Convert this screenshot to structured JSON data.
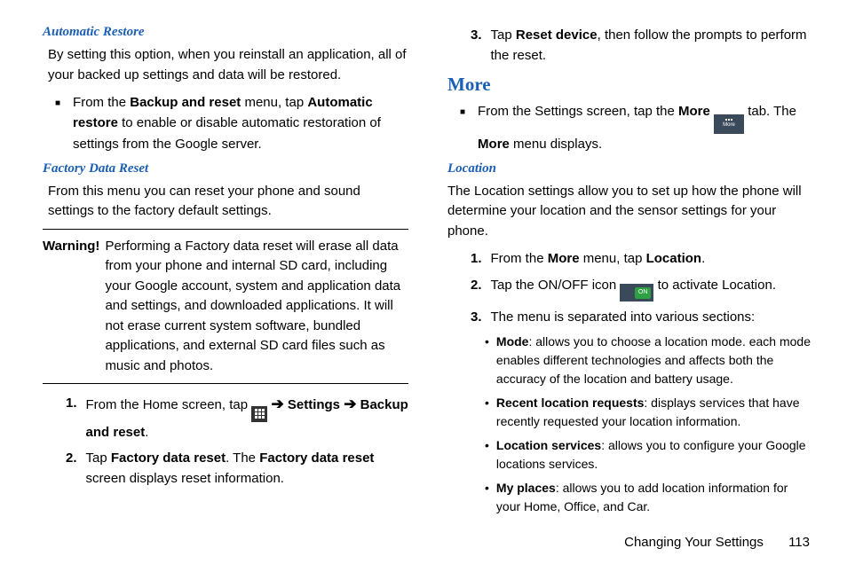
{
  "left": {
    "h_auto_restore": "Automatic Restore",
    "p_auto_restore": "By setting this option, when you reinstall an application, all of your backed up settings and data will be restored.",
    "b_auto_1a": "From the ",
    "b_auto_1b": "Backup and reset",
    "b_auto_1c": " menu, tap ",
    "b_auto_1d": "Automatic restore",
    "b_auto_1e": " to enable or disable automatic restoration of settings from the Google server.",
    "h_factory": "Factory Data Reset",
    "p_factory": "From this menu you can reset your phone and sound settings to the factory default settings.",
    "warn_label": "Warning!",
    "warn_text": "Performing a Factory data reset will erase all data from your phone and internal SD card, including your Google account, system and application data and settings, and downloaded applications. It will not erase current system software, bundled applications, and external SD card files such as music and photos.",
    "n1": "1.",
    "n1a": "From the Home screen, tap ",
    "n1b": " Settings ",
    "n1c": " Backup and reset",
    "n2": "2.",
    "n2a": "Tap ",
    "n2b": "Factory data reset",
    "n2c": ". The ",
    "n2d": "Factory data reset",
    "n2e": " screen displays reset information."
  },
  "right": {
    "n3": "3.",
    "n3a": "Tap ",
    "n3b": "Reset device",
    "n3c": ", then follow the prompts to perform the reset.",
    "h_more": "More",
    "bm_a": "From the Settings screen, tap the ",
    "bm_b": "More",
    "bm_c": " tab. The ",
    "bm_d": "More",
    "bm_e": " menu displays.",
    "more_icon_label": "More",
    "h_location": "Location",
    "p_location": "The Location settings allow you to set up how the phone will determine your location and the sensor settings for your phone.",
    "l1": "1.",
    "l1a": "From the ",
    "l1b": "More",
    "l1c": " menu, tap ",
    "l1d": "Location",
    "l2": "2.",
    "l2a": "Tap the ON/OFF icon ",
    "l2b": " to activate Location.",
    "on_label": "ON",
    "l3": "3.",
    "l3a": "The menu is separated into various sections:",
    "d1k": "Mode",
    "d1v": ": allows you to choose a location mode. each mode enables different technologies and affects both the accuracy of the location and battery usage.",
    "d2k": "Recent location requests",
    "d2v": ": displays services that have recently requested your location information.",
    "d3k": "Location services",
    "d3v": ": allows you to configure your Google locations services.",
    "d4k": "My places",
    "d4v": ": allows you to add location information for your Home, Office, and Car."
  },
  "footer": {
    "section": "Changing Your Settings",
    "page": "113"
  }
}
